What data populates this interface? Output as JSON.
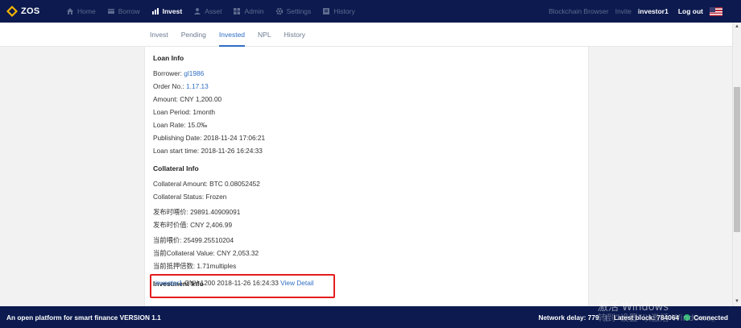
{
  "app": {
    "name": "ZOS"
  },
  "nav": {
    "items": [
      {
        "label": "Home",
        "icon": "home-icon",
        "active": false
      },
      {
        "label": "Borrow",
        "icon": "borrow-icon",
        "active": false
      },
      {
        "label": "Invest",
        "icon": "invest-icon",
        "active": true
      },
      {
        "label": "Asset",
        "icon": "asset-icon",
        "active": false
      },
      {
        "label": "Admin",
        "icon": "admin-icon",
        "active": false
      },
      {
        "label": "Settings",
        "icon": "gear-icon",
        "active": false
      },
      {
        "label": "History",
        "icon": "history-icon",
        "active": false
      }
    ],
    "right": {
      "blockchain_browser": "Blockchain Browser",
      "invite": "Invite",
      "user": "investor1",
      "logout": "Log out",
      "flag": "us-flag-icon"
    }
  },
  "subtabs": [
    {
      "label": "Invest",
      "active": false
    },
    {
      "label": "Pending",
      "active": false
    },
    {
      "label": "Invested",
      "active": true
    },
    {
      "label": "NPL",
      "active": false
    },
    {
      "label": "History",
      "active": false
    }
  ],
  "loan_info": {
    "title": "Loan Info",
    "borrower_label": "Borrower: ",
    "borrower": "gl1986",
    "order_label": "Order No.: ",
    "order_no": "1.17.13",
    "amount": "Amount: CNY 1,200.00",
    "period": "Loan Period: 1month",
    "rate": "Loan Rate: 15.0‰",
    "publishing_date": "Publishing Date: 2018-11-24 17:06:21",
    "start_time": "Loan start time: 2018-11-26 16:24:33"
  },
  "collateral_info": {
    "title": "Collateral Info",
    "amount": "Collateral Amount: BTC 0.08052452",
    "status": "Collateral Status: Frozen",
    "publish_price": "发布时喂价: 29891.40909091",
    "publish_value": "发布时价值: CNY 2,406.99",
    "current_price": "当前喂价: 25499.25510204",
    "current_value": "当前Collateral Value: CNY 2,053.32",
    "current_ratio": "当前抵押倍数: 1.71multiples"
  },
  "investment_info": {
    "title": "Investment Info",
    "investor": "investor1",
    "detail": " CNY 1200 2018-11-26 16:24:33 ",
    "view_detail": "View Detail"
  },
  "status_bar": {
    "platform": "An open platform for smart finance VERSION 1.1",
    "network_delay": "Network delay: 779",
    "separator": "|",
    "latest_block": "Latest block: 784064",
    "connected": "Connected"
  },
  "watermark": {
    "line1": "激活 Windows",
    "line2": "转到“设置”以激活 Windows。"
  },
  "colors": {
    "navbar": "#0c1a4f",
    "accent": "#2f6ec4",
    "highlight_box": "#e41e1e",
    "connected": "#2bb673"
  }
}
